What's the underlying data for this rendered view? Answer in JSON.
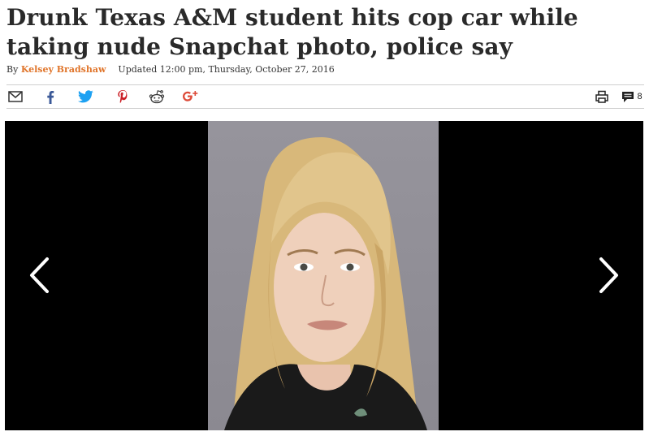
{
  "article": {
    "headline": "Drunk Texas A&M student hits cop car while taking nude Snapchat photo, police say",
    "byline_prefix": "By",
    "author": "Kelsey Bradshaw",
    "updated": "Updated 12:00 pm, Thursday, October 27, 2016"
  },
  "share_bar": {
    "icons": [
      "mail-icon",
      "facebook-icon",
      "twitter-icon",
      "pinterest-icon",
      "reddit-icon",
      "google-plus-icon"
    ],
    "comment_count": "8"
  },
  "gallery": {
    "background": "#000000",
    "prev_label": "previous photo",
    "next_label": "next photo"
  },
  "colors": {
    "author": "#e0752b",
    "facebook": "#3b5998",
    "twitter": "#1da1f2",
    "pinterest": "#cb2027",
    "google_plus": "#dd4b39",
    "divider": "#cfcfcf"
  }
}
